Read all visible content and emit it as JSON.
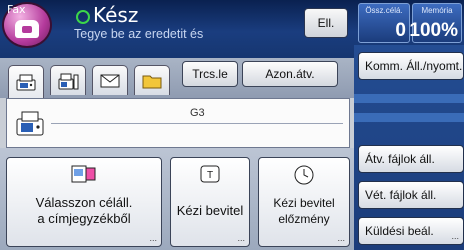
{
  "header": {
    "app_label": "Fax",
    "status": "Kész",
    "hint": "Tegye be az eredetit és",
    "clear_label": "Ell.",
    "counters": [
      {
        "label": "Össz.célá.",
        "value": "0"
      },
      {
        "label": "Memória",
        "value": "100%"
      }
    ]
  },
  "tabs": {
    "items": [
      {
        "name": "machine-tab-icon"
      },
      {
        "name": "internet-fax-tab-icon"
      },
      {
        "name": "mail-tab-icon"
      },
      {
        "name": "folder-tab-icon"
      }
    ],
    "buttons": [
      {
        "label": "Trcs.le"
      },
      {
        "label": "Azon.átv."
      }
    ]
  },
  "destination": {
    "line_type": "G3"
  },
  "right_menu": {
    "items": [
      {
        "label": "Komm. Áll./nyomt."
      },
      {
        "label": "Átv. fájlok áll."
      },
      {
        "label": "Vét. fájlok áll."
      },
      {
        "label": "Küldési beál."
      }
    ],
    "ellipsis": "..."
  },
  "bottom_buttons": [
    {
      "line1": "Válasszon céláll.",
      "line2": "a címjegyzékből",
      "icon": "address-book-icon"
    },
    {
      "line1": "Kézi bevitel",
      "line2": "",
      "icon": "keypad-icon"
    },
    {
      "line1": "Kézi bevitel",
      "line2": "előzmény",
      "icon": "clock-icon"
    }
  ],
  "colors": {
    "header_bg": "#132e63",
    "status_ring": "#3cd64a",
    "app_icon": "#b43a9c"
  }
}
